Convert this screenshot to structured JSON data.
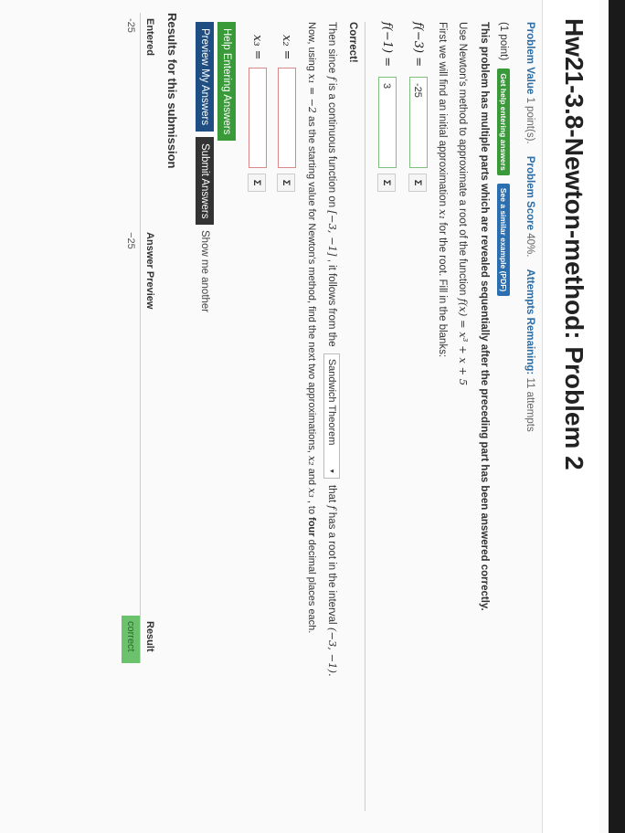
{
  "header": {
    "title": "Hw21-3.8-Newton-method: Problem 2"
  },
  "info": {
    "problem_value_label": "Problem Value",
    "problem_value": "1 point(s).",
    "problem_score_label": "Problem Score",
    "problem_score": "40%.",
    "attempts_label": "Attempts Remaining:",
    "attempts": "11 attempts"
  },
  "problem": {
    "points": "(1 point)",
    "help_badge": "Get help entering answers",
    "example_badge": "See a similar example (PDF)",
    "notice": "This problem has multiple parts which are revealed sequentially after the preceding part has been answered correctly.",
    "instruction_text": "Use Newton's method to approximate a root of the function",
    "function": "f(x) = x³ + x + 5",
    "first_step_text": "First we will find an initial approximation",
    "first_step_var": "x₁",
    "first_step_tail": "for the root. Fill in the blanks:",
    "answers": [
      {
        "label": "f(−3) =",
        "value": "-25"
      },
      {
        "label": "f(−1) =",
        "value": "3"
      }
    ],
    "sigma": "Σ",
    "correct_label": "Correct!",
    "then_prefix": "Then since",
    "then_f": "f",
    "then_mid": "is a continuous function on",
    "then_interval": "[−3, −1]",
    "then_follows": ", it follows from the",
    "theorem_select": "Sandwich Theorem",
    "theorem_caret": "▾",
    "then_suffix": "that",
    "then_f2": "f",
    "then_root": "has a root in the interval",
    "then_interval2": "(−3, −1).",
    "now_prefix": "Now, using",
    "now_x1": "x₁ = −2",
    "now_mid": "as the starting value for Newton's method, find the next two approximations,",
    "now_x2": "x₂",
    "now_and": "and",
    "now_x3": "x₃",
    "now_to": ", to",
    "now_four": "four",
    "now_tail": "decimal places each.",
    "x2_label": "x₂ =",
    "x3_label": "x₃ ="
  },
  "buttons": {
    "help": "Help Entering Answers",
    "preview": "Preview My Answers",
    "submit": "Submit Answers",
    "show_another": "Show me another"
  },
  "results": {
    "title": "Results for this submission",
    "headers": [
      "Entered",
      "Answer Preview",
      "Result"
    ],
    "rows": [
      {
        "entered": "-25",
        "preview": "−25",
        "result": "correct"
      }
    ]
  }
}
